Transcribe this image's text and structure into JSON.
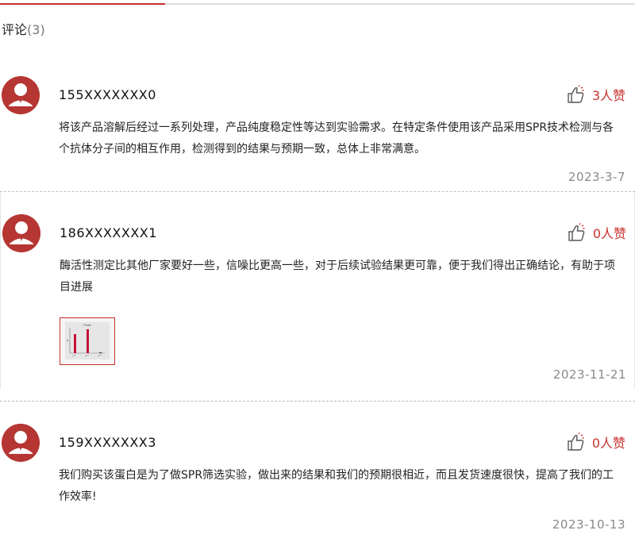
{
  "section": {
    "title": "评论",
    "count": "(3)"
  },
  "comments": [
    {
      "user": "155XXXXXXX0",
      "likes": "3人赞",
      "text": "将该产品溶解后经过一系列处理，产品纯度稳定性等达到实验需求。在特定条件使用该产品采用SPR技术检测与各个抗体分子间的相互作用，检测得到的结果与预期一致，总体上非常满意。",
      "date": "2023-3-7"
    },
    {
      "user": "186XXXXXXX1",
      "likes": "0人赞",
      "text": "酶活性测定比其他厂家要好一些，信噪比更高一些，对于后续试验结果更可靠，便于我们得出正确结论，有助于项目进展",
      "date": "2023-11-21",
      "image": {
        "caption": "Prote"
      }
    },
    {
      "user": "159XXXXXXX3",
      "likes": "0人赞",
      "text": "我们购买该蛋白是为了做SPR筛选实验，做出来的结果和我们的预期很相近，而且发货速度很快，提高了我们的工作效率!",
      "date": "2023-10-13"
    }
  ],
  "colors": {
    "accent": "#c9312e",
    "avatar": "#b53632",
    "date": "#8a8a8a"
  },
  "icons": {
    "avatar": "user-avatar-icon",
    "like": "thumbs-up-icon"
  }
}
